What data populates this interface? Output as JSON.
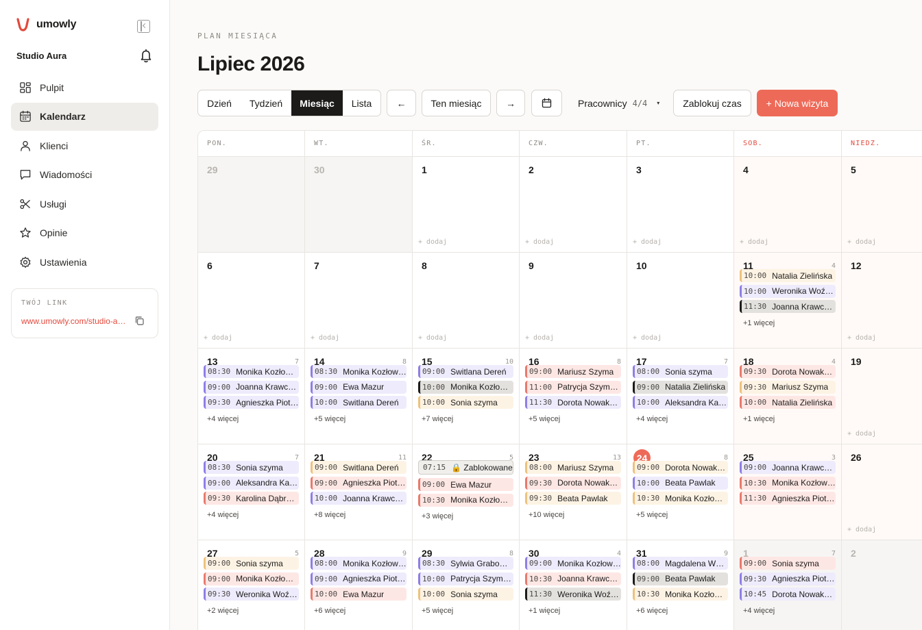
{
  "app": {
    "brand_name": "umowly",
    "studio_name": "Studio Aura",
    "brand_color": "#e2493c"
  },
  "sidebar": {
    "items": [
      {
        "label": "Pulpit",
        "icon": "grid-icon",
        "active": false
      },
      {
        "label": "Kalendarz",
        "icon": "calendar-icon",
        "active": true
      },
      {
        "label": "Klienci",
        "icon": "users-icon",
        "active": false
      },
      {
        "label": "Wiadomości",
        "icon": "message-icon",
        "active": false
      },
      {
        "label": "Usługi",
        "icon": "scissors-icon",
        "active": false
      },
      {
        "label": "Opinie",
        "icon": "star-icon",
        "active": false
      },
      {
        "label": "Ustawienia",
        "icon": "gear-icon",
        "active": false
      }
    ],
    "link_label": "TWÓJ LINK",
    "link_url": "www.umowly.com/studio-aura"
  },
  "header": {
    "eyebrow": "PLAN MIESIĄCA",
    "title": "Lipiec 2026"
  },
  "toolbar": {
    "views": [
      "Dzień",
      "Tydzień",
      "Miesiąc",
      "Lista"
    ],
    "active_view": "Miesiąc",
    "prev_label": "←",
    "this_month_label": "Ten miesiąc",
    "next_label": "→",
    "workers_label": "Pracownicy",
    "workers_count": "4/4",
    "workers_caret": "▾",
    "block_label": "Zablokuj czas",
    "new_visit_label": "+ Nowa wizyta"
  },
  "calendar": {
    "weekdays": [
      "PON.",
      "WT.",
      "ŚR.",
      "CZW.",
      "PT.",
      "SOB.",
      "NIEDZ."
    ],
    "add_label": "+ dodaj",
    "more_suffix": "więcej",
    "weeks": [
      [
        {
          "day": "29",
          "out": true
        },
        {
          "day": "30",
          "out": true
        },
        {
          "day": "1",
          "add": true,
          "events": []
        },
        {
          "day": "2",
          "add": true,
          "events": []
        },
        {
          "day": "3",
          "add": true,
          "events": []
        },
        {
          "day": "4",
          "add": true,
          "events": []
        },
        {
          "day": "5",
          "add": true,
          "events": []
        }
      ],
      [
        {
          "day": "6",
          "add": true,
          "events": []
        },
        {
          "day": "7",
          "add": true,
          "events": []
        },
        {
          "day": "8",
          "add": true,
          "events": []
        },
        {
          "day": "9",
          "add": true,
          "events": []
        },
        {
          "day": "10",
          "add": true,
          "events": []
        },
        {
          "day": "11",
          "count": "4",
          "more": "+1",
          "events": [
            {
              "time": "10:00",
              "name": "Natalia Zielińska",
              "color": "yellow"
            },
            {
              "time": "10:00",
              "name": "Weronika Woźniak",
              "color": "purple"
            },
            {
              "time": "11:30",
              "name": "Joanna Krawczyk",
              "color": "gray"
            }
          ]
        },
        {
          "day": "12",
          "add": true,
          "events": []
        }
      ],
      [
        {
          "day": "13",
          "count": "7",
          "more": "+4",
          "events": [
            {
              "time": "08:30",
              "name": "Monika Kozłowska",
              "color": "purple"
            },
            {
              "time": "09:00",
              "name": "Joanna Krawczyk",
              "color": "purple"
            },
            {
              "time": "09:30",
              "name": "Agnieszka Piotrowska",
              "color": "purple"
            }
          ]
        },
        {
          "day": "14",
          "count": "8",
          "more": "+5",
          "events": [
            {
              "time": "08:30",
              "name": "Monika Kozłowska",
              "color": "purple"
            },
            {
              "time": "09:00",
              "name": "Ewa Mazur",
              "color": "purple"
            },
            {
              "time": "10:00",
              "name": "Switlana Dereń",
              "color": "purple"
            }
          ]
        },
        {
          "day": "15",
          "count": "10",
          "more": "+7",
          "events": [
            {
              "time": "09:00",
              "name": "Switlana Dereń",
              "color": "purple"
            },
            {
              "time": "10:00",
              "name": "Monika Kozłowska",
              "color": "gray"
            },
            {
              "time": "10:00",
              "name": "Sonia szyma",
              "color": "yellow"
            }
          ]
        },
        {
          "day": "16",
          "count": "8",
          "more": "+5",
          "events": [
            {
              "time": "09:00",
              "name": "Mariusz Szyma",
              "color": "red"
            },
            {
              "time": "11:00",
              "name": "Patrycja Szymańska",
              "color": "red"
            },
            {
              "time": "11:30",
              "name": "Dorota Nowakowska",
              "color": "purple"
            }
          ]
        },
        {
          "day": "17",
          "count": "7",
          "more": "+4",
          "events": [
            {
              "time": "08:00",
              "name": "Sonia szyma",
              "color": "purple"
            },
            {
              "time": "09:00",
              "name": "Natalia Zielińska",
              "color": "gray"
            },
            {
              "time": "10:00",
              "name": "Aleksandra Kaczmarek",
              "color": "purple"
            }
          ]
        },
        {
          "day": "18",
          "count": "4",
          "more": "+1",
          "events": [
            {
              "time": "09:30",
              "name": "Dorota Nowakowska",
              "color": "red"
            },
            {
              "time": "09:30",
              "name": "Mariusz Szyma",
              "color": "yellow"
            },
            {
              "time": "10:00",
              "name": "Natalia Zielińska",
              "color": "red"
            }
          ]
        },
        {
          "day": "19",
          "add": true,
          "events": []
        }
      ],
      [
        {
          "day": "20",
          "count": "7",
          "more": "+4",
          "events": [
            {
              "time": "08:30",
              "name": "Sonia szyma",
              "color": "purple"
            },
            {
              "time": "09:00",
              "name": "Aleksandra Kaczmarek",
              "color": "purple"
            },
            {
              "time": "09:30",
              "name": "Karolina Dąbrowska",
              "color": "red"
            }
          ]
        },
        {
          "day": "21",
          "count": "11",
          "more": "+8",
          "events": [
            {
              "time": "09:00",
              "name": "Switlana Dereń",
              "color": "yellow"
            },
            {
              "time": "09:00",
              "name": "Agnieszka Piotrowska",
              "color": "red"
            },
            {
              "time": "10:00",
              "name": "Joanna Krawczyk",
              "color": "purple"
            }
          ]
        },
        {
          "day": "22",
          "count": "5",
          "more": "+3",
          "blocked": {
            "time": "07:15",
            "label": "🔒 Zablokowane"
          },
          "events": [
            {
              "time": "09:00",
              "name": "Ewa Mazur",
              "color": "red"
            },
            {
              "time": "10:30",
              "name": "Monika Kozłowska",
              "color": "red"
            }
          ]
        },
        {
          "day": "23",
          "count": "13",
          "more": "+10",
          "events": [
            {
              "time": "08:00",
              "name": "Mariusz Szyma",
              "color": "yellow"
            },
            {
              "time": "09:30",
              "name": "Dorota Nowakowska",
              "color": "red"
            },
            {
              "time": "09:30",
              "name": "Beata Pawlak",
              "color": "yellow"
            }
          ]
        },
        {
          "day": "24",
          "today": true,
          "count": "8",
          "more": "+5",
          "events": [
            {
              "time": "09:00",
              "name": "Dorota Nowakowska",
              "color": "yellow"
            },
            {
              "time": "10:00",
              "name": "Beata Pawlak",
              "color": "purple"
            },
            {
              "time": "10:30",
              "name": "Monika Kozłowska",
              "color": "yellow"
            }
          ]
        },
        {
          "day": "25",
          "count": "3",
          "events": [
            {
              "time": "09:00",
              "name": "Joanna Krawczyk",
              "color": "purple"
            },
            {
              "time": "10:30",
              "name": "Monika Kozłowska",
              "color": "red"
            },
            {
              "time": "11:30",
              "name": "Agnieszka Piotrowska",
              "color": "red"
            }
          ]
        },
        {
          "day": "26",
          "add": true,
          "events": []
        }
      ],
      [
        {
          "day": "27",
          "count": "5",
          "more": "+2",
          "events": [
            {
              "time": "09:00",
              "name": "Sonia szyma",
              "color": "yellow"
            },
            {
              "time": "09:00",
              "name": "Monika Kozłowska",
              "color": "red"
            },
            {
              "time": "09:30",
              "name": "Weronika Woźniak",
              "color": "purple"
            }
          ]
        },
        {
          "day": "28",
          "count": "9",
          "more": "+6",
          "events": [
            {
              "time": "08:00",
              "name": "Monika Kozłowska",
              "color": "purple"
            },
            {
              "time": "09:00",
              "name": "Agnieszka Piotrowska",
              "color": "purple"
            },
            {
              "time": "10:00",
              "name": "Ewa Mazur",
              "color": "red"
            }
          ]
        },
        {
          "day": "29",
          "count": "8",
          "more": "+5",
          "events": [
            {
              "time": "08:30",
              "name": "Sylwia Grabowska",
              "color": "purple"
            },
            {
              "time": "10:00",
              "name": "Patrycja Szymańska",
              "color": "purple"
            },
            {
              "time": "10:00",
              "name": "Sonia szyma",
              "color": "yellow"
            }
          ]
        },
        {
          "day": "30",
          "count": "4",
          "more": "+1",
          "events": [
            {
              "time": "09:00",
              "name": "Monika Kozłowska",
              "color": "purple"
            },
            {
              "time": "10:30",
              "name": "Joanna Krawczyk",
              "color": "red"
            },
            {
              "time": "11:30",
              "name": "Weronika Woźniak",
              "color": "gray"
            }
          ]
        },
        {
          "day": "31",
          "count": "9",
          "more": "+6",
          "events": [
            {
              "time": "08:00",
              "name": "Magdalena Wójcik",
              "color": "purple"
            },
            {
              "time": "09:00",
              "name": "Beata Pawlak",
              "color": "gray"
            },
            {
              "time": "10:30",
              "name": "Monika Kozłowska",
              "color": "yellow"
            }
          ]
        },
        {
          "day": "1",
          "out": true,
          "count": "7",
          "more": "+4",
          "events": [
            {
              "time": "09:00",
              "name": "Sonia szyma",
              "color": "red"
            },
            {
              "time": "09:30",
              "name": "Agnieszka Piotrowska",
              "color": "purple"
            },
            {
              "time": "10:45",
              "name": "Dorota Nowakowska",
              "color": "purple"
            }
          ]
        },
        {
          "day": "2",
          "out": true,
          "events": []
        }
      ]
    ]
  }
}
